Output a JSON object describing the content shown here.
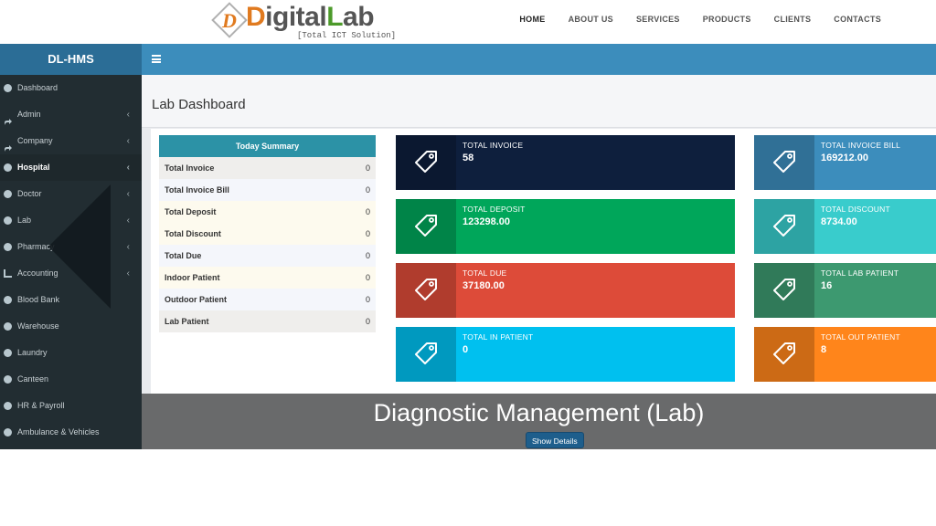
{
  "site": {
    "logo": {
      "mark_letter": "D",
      "wordmark_d": "D",
      "wordmark_mid": "igital",
      "wordmark_l": "L",
      "wordmark_end": "ab",
      "tagline": "[Total ICT Solution]"
    },
    "nav": [
      {
        "label": "HOME"
      },
      {
        "label": "ABOUT US"
      },
      {
        "label": "SERVICES"
      },
      {
        "label": "PRODUCTS"
      },
      {
        "label": "CLIENTS"
      },
      {
        "label": "CONTACTS"
      }
    ]
  },
  "sidebar": {
    "brand": "DL-HMS",
    "items": [
      {
        "label": "Dashboard"
      },
      {
        "label": "Admin",
        "chevron": "‹"
      },
      {
        "label": "Company",
        "chevron": "‹"
      },
      {
        "label": "Hospital",
        "chevron": "‹"
      },
      {
        "label": "Doctor",
        "chevron": "‹"
      },
      {
        "label": "Lab",
        "chevron": "‹"
      },
      {
        "label": "Pharmacy",
        "chevron": "‹"
      },
      {
        "label": "Accounting",
        "chevron": "‹"
      },
      {
        "label": "Blood Bank"
      },
      {
        "label": "Warehouse"
      },
      {
        "label": "Laundry"
      },
      {
        "label": "Canteen"
      },
      {
        "label": "HR & Payroll"
      },
      {
        "label": "Ambulance & Vehicles"
      }
    ]
  },
  "main": {
    "title": "Lab Dashboard",
    "summary": {
      "heading": "Today Summary",
      "rows": [
        {
          "label": "Total Invoice",
          "value": "0"
        },
        {
          "label": "Total Invoice Bill",
          "value": "0"
        },
        {
          "label": "Total Deposit",
          "value": "0"
        },
        {
          "label": "Total Discount",
          "value": "0"
        },
        {
          "label": "Total Due",
          "value": "0"
        },
        {
          "label": "Indoor Patient",
          "value": "0"
        },
        {
          "label": "Outdoor Patient",
          "value": "0"
        },
        {
          "label": "Lab Patient",
          "value": "0"
        }
      ]
    },
    "boxes": [
      {
        "label": "TOTAL INVOICE",
        "value": "58",
        "color": "#0e1f3d"
      },
      {
        "label": "TOTAL INVOICE BILL",
        "value": "169212.00",
        "color": "#3c8dbc"
      },
      {
        "label": "TOTAL DEPOSIT",
        "value": "123298.00",
        "color": "#00a65a"
      },
      {
        "label": "TOTAL DISCOUNT",
        "value": "8734.00",
        "color": "#39cccc"
      },
      {
        "label": "TOTAL DUE",
        "value": "37180.00",
        "color": "#dd4b39"
      },
      {
        "label": "TOTAL LAB PATIENT",
        "value": "16",
        "color": "#3d9970"
      },
      {
        "label": "TOTAL IN PATIENT",
        "value": "0",
        "color": "#00c0ef"
      },
      {
        "label": "TOTAL OUT PATIENT",
        "value": "8",
        "color": "#ff851b"
      }
    ]
  },
  "overlay": {
    "title": "Diagnostic Management (Lab)",
    "button": "Show Details"
  }
}
